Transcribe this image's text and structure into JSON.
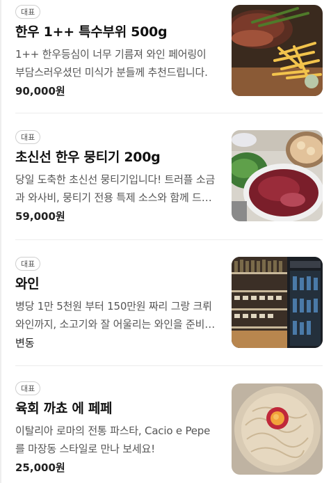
{
  "menu_items": [
    {
      "badge": "대표",
      "name": "한우 1++ 특수부위 500g",
      "description": "1++ 한우등심이 너무 기름져 와인 페어링이 부담스러우셨던 미식가 분들께 추천드립니다.",
      "price": "90,000원",
      "image": "steak-with-fries-photo"
    },
    {
      "badge": "대표",
      "name": "초신선 한우 뭉티기 200g",
      "description": "당일 도축한 초신선 뭉티기입니다! 트러플 소금과 와사비, 뭉티기 전용 특제 소스와 함께 드세요.",
      "price": "59,000원",
      "image": "raw-beef-platter-photo"
    },
    {
      "badge": "대표",
      "name": "와인",
      "description": "병당 1만 5천원 부터 150만원 짜리 그랑 크뤼 와인까지, 소고기와 잘 어울리는 와인을 준비했습니다.",
      "price": "변동",
      "image": "wine-cellar-photo"
    },
    {
      "badge": "대표",
      "name": "육회 까쵸 에 페페",
      "description": "이탈리아 로마의 전통 파스타, Cacio e Pepe 를 마장동 스타일로 만나 보세요!",
      "price": "25,000원",
      "image": "cacio-e-pepe-pasta-photo"
    }
  ]
}
